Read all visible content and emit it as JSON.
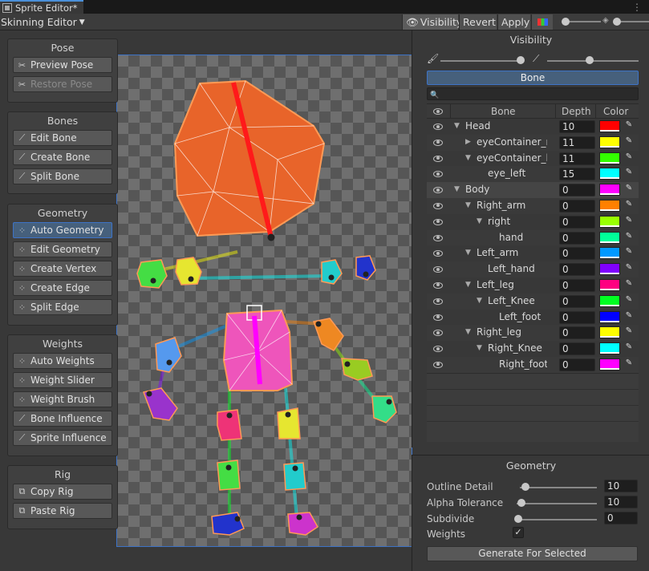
{
  "window": {
    "tab_title": "Sprite Editor*"
  },
  "toolbar": {
    "mode": "Skinning Editor",
    "visibility": "Visibility",
    "revert": "Revert",
    "apply": "Apply"
  },
  "left_panels": {
    "pose": {
      "title": "Pose",
      "buttons": [
        "Preview Pose",
        "Restore Pose"
      ]
    },
    "bones": {
      "title": "Bones",
      "buttons": [
        "Edit Bone",
        "Create Bone",
        "Split Bone"
      ]
    },
    "geometry": {
      "title": "Geometry",
      "buttons": [
        "Auto Geometry",
        "Edit Geometry",
        "Create Vertex",
        "Create Edge",
        "Split Edge"
      ]
    },
    "weights": {
      "title": "Weights",
      "buttons": [
        "Auto Weights",
        "Weight Slider",
        "Weight Brush",
        "Bone Influence",
        "Sprite Influence"
      ]
    },
    "rig": {
      "title": "Rig",
      "buttons": [
        "Copy Rig",
        "Paste Rig"
      ]
    }
  },
  "visibility": {
    "title": "Visibility",
    "tab": "Bone",
    "columns": {
      "bone": "Bone",
      "depth": "Depth",
      "color": "Color"
    },
    "bones": [
      {
        "name": "Head",
        "depth": "10",
        "color": "#ff0000",
        "indent": 0,
        "caret": "open"
      },
      {
        "name": "eyeContainer_right",
        "depth": "11",
        "color": "#ffff00",
        "indent": 1,
        "caret": "closed"
      },
      {
        "name": "eyeContainer_left",
        "depth": "11",
        "color": "#33ff00",
        "indent": 1,
        "caret": "open"
      },
      {
        "name": "eye_left",
        "depth": "15",
        "color": "#00ffff",
        "indent": 2,
        "caret": ""
      },
      {
        "name": "Body",
        "depth": "0",
        "color": "#ff00ff",
        "indent": 0,
        "caret": "open"
      },
      {
        "name": "Right_arm",
        "depth": "0",
        "color": "#ff8000",
        "indent": 1,
        "caret": "open"
      },
      {
        "name": "right",
        "depth": "0",
        "color": "#99ff00",
        "indent": 2,
        "caret": "open"
      },
      {
        "name": "hand",
        "depth": "0",
        "color": "#00ff99",
        "indent": 3,
        "caret": ""
      },
      {
        "name": "Left_arm",
        "depth": "0",
        "color": "#0099ff",
        "indent": 1,
        "caret": "open"
      },
      {
        "name": "Left_hand",
        "depth": "0",
        "color": "#8000ff",
        "indent": 2,
        "caret": ""
      },
      {
        "name": "Left_leg",
        "depth": "0",
        "color": "#ff0080",
        "indent": 1,
        "caret": "open"
      },
      {
        "name": "Left_Knee",
        "depth": "0",
        "color": "#00ff22",
        "indent": 2,
        "caret": "open"
      },
      {
        "name": "Left_foot",
        "depth": "0",
        "color": "#0000ff",
        "indent": 3,
        "caret": ""
      },
      {
        "name": "Right_leg",
        "depth": "0",
        "color": "#ffff00",
        "indent": 1,
        "caret": "open"
      },
      {
        "name": "Right_Knee",
        "depth": "0",
        "color": "#00ffff",
        "indent": 2,
        "caret": "open"
      },
      {
        "name": "Right_foot",
        "depth": "0",
        "color": "#ff00ff",
        "indent": 3,
        "caret": ""
      }
    ]
  },
  "geometry": {
    "title": "Geometry",
    "outline_detail_label": "Outline Detail",
    "outline_detail": "10",
    "alpha_tolerance_label": "Alpha Tolerance",
    "alpha_tolerance": "10",
    "subdivide_label": "Subdivide",
    "subdivide": "0",
    "weights_label": "Weights",
    "weights_checked": true,
    "generate": "Generate For Selected"
  }
}
